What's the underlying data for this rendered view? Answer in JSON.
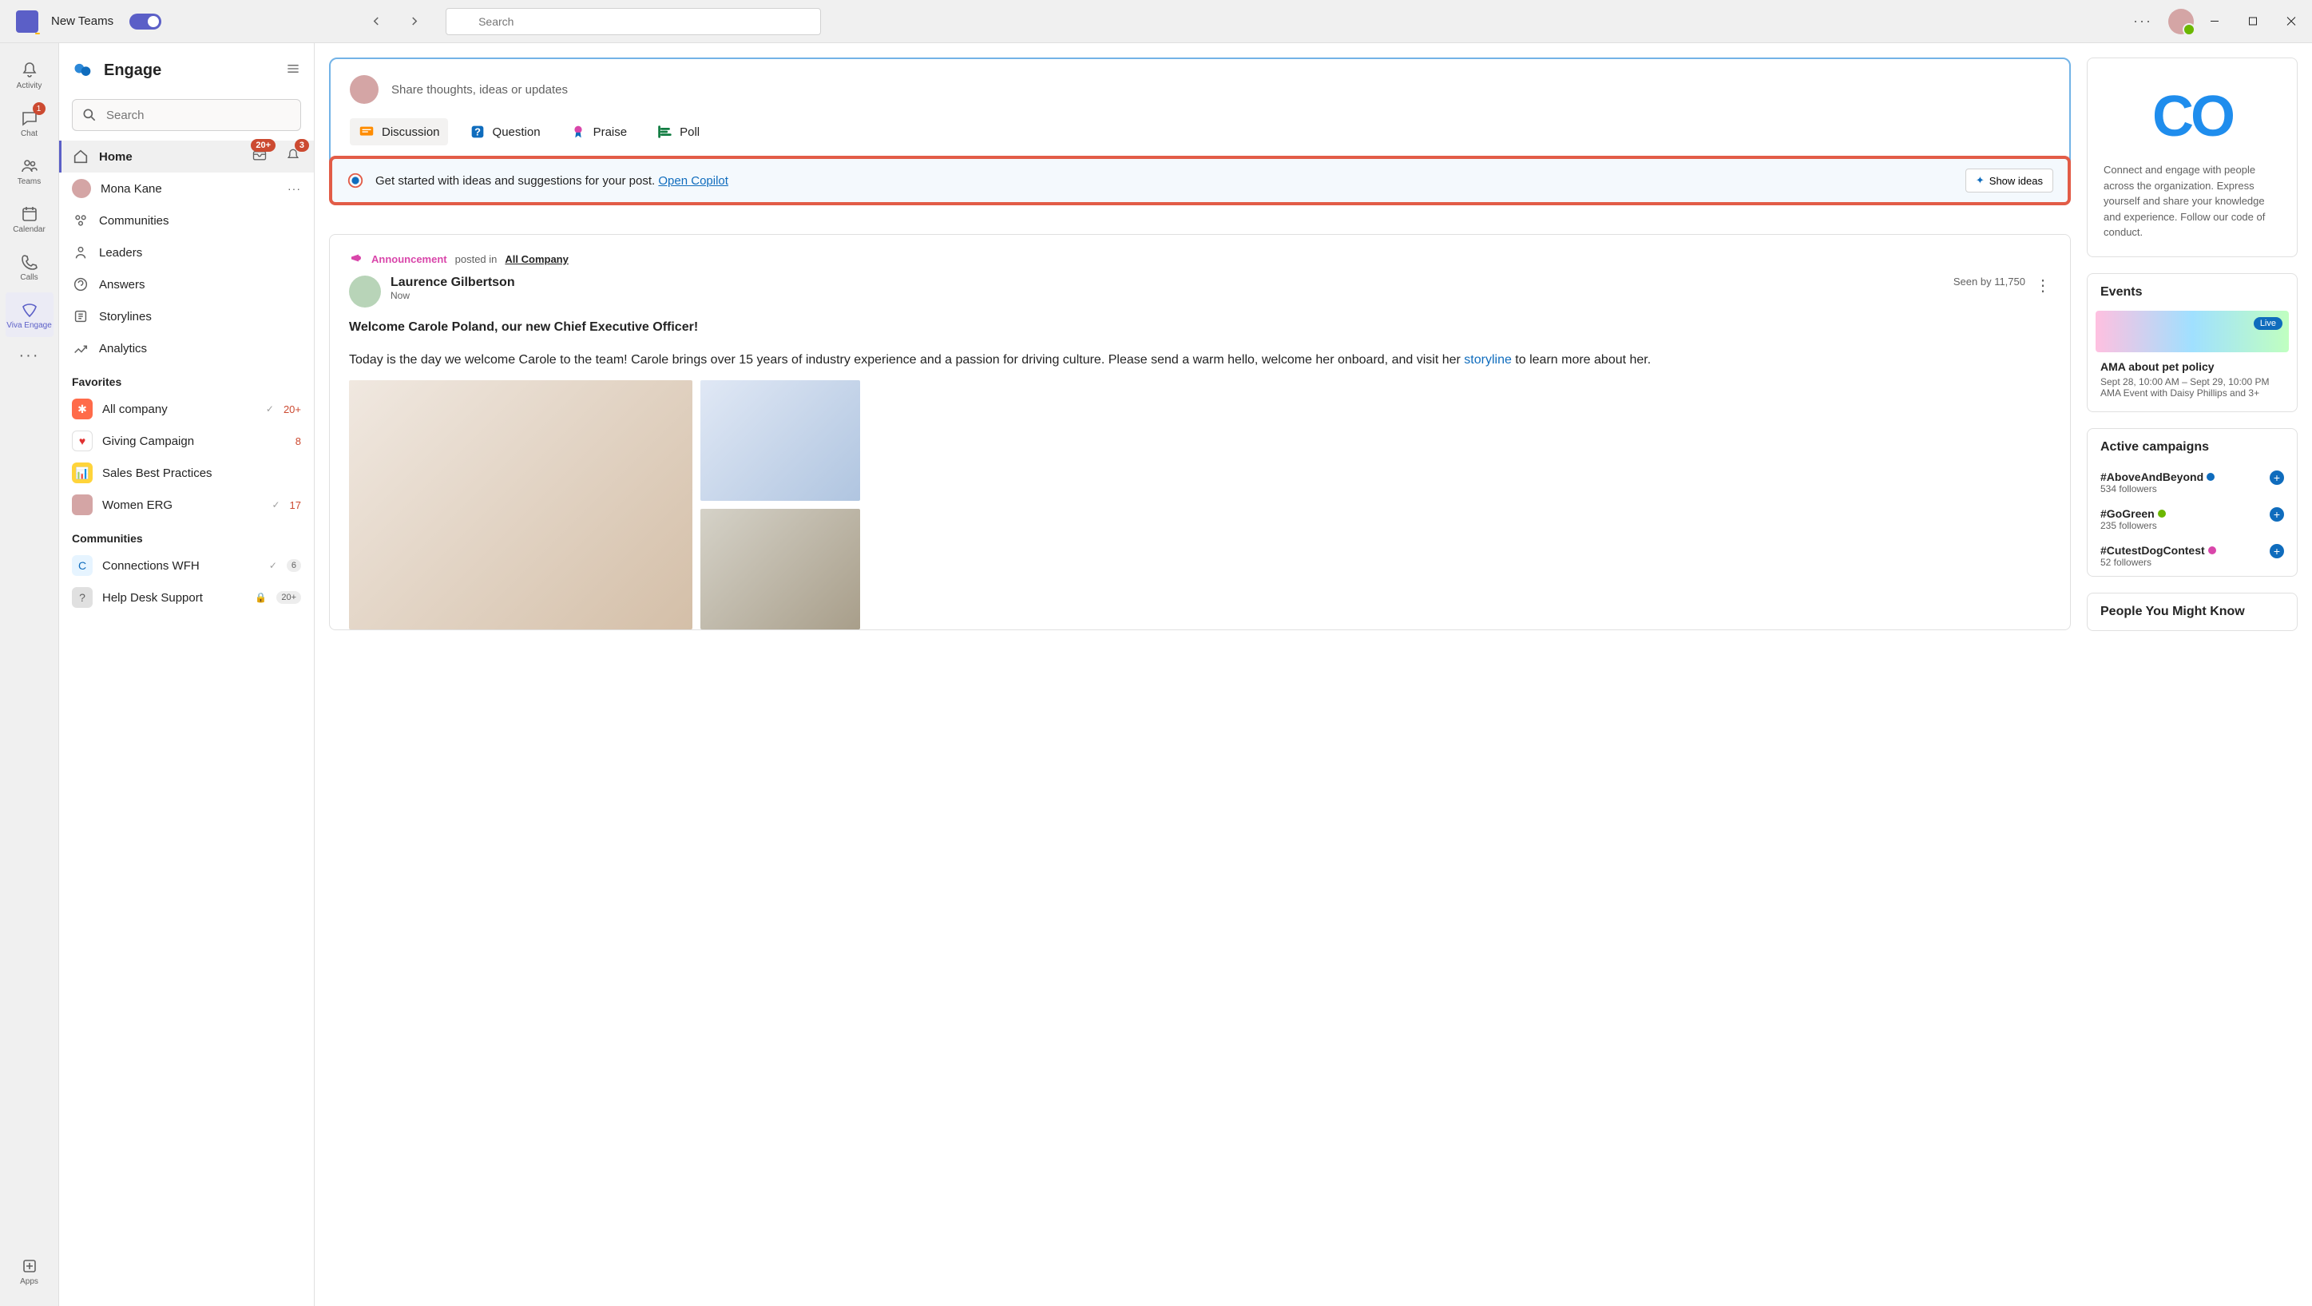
{
  "titlebar": {
    "app_name": "New Teams",
    "search_placeholder": "Search",
    "more": "···"
  },
  "rail": [
    {
      "key": "activity",
      "label": "Activity"
    },
    {
      "key": "chat",
      "label": "Chat",
      "badge": "1"
    },
    {
      "key": "teams",
      "label": "Teams"
    },
    {
      "key": "calendar",
      "label": "Calendar"
    },
    {
      "key": "calls",
      "label": "Calls"
    },
    {
      "key": "viva",
      "label": "Viva Engage"
    },
    {
      "key": "apps",
      "label": "Apps"
    }
  ],
  "sidebar": {
    "title": "Engage",
    "search_placeholder": "Search",
    "home": {
      "label": "Home",
      "inbox_badge": "20+",
      "bell_badge": "3"
    },
    "user": {
      "name": "Mona Kane"
    },
    "nav": [
      {
        "label": "Communities"
      },
      {
        "label": "Leaders"
      },
      {
        "label": "Answers"
      },
      {
        "label": "Storylines"
      },
      {
        "label": "Analytics"
      }
    ],
    "fav_header": "Favorites",
    "favorites": [
      {
        "label": "All company",
        "count": "20+",
        "count_class": "",
        "bg": "#ff6b4a"
      },
      {
        "label": "Giving Campaign",
        "count": "8",
        "count_class": "",
        "bg": "#fff",
        "fg": "#e03131"
      },
      {
        "label": "Sales Best Practices",
        "count": "",
        "count_class": "",
        "bg": "#ffd43b"
      },
      {
        "label": "Women ERG",
        "count": "17",
        "count_class": "",
        "bg": "#d4a5a5"
      }
    ],
    "comm_header": "Communities",
    "communities": [
      {
        "label": "Connections WFH",
        "count": "6",
        "bg": "#e6f4ff",
        "fg": "#0f6cbd"
      },
      {
        "label": "Help Desk Support",
        "count": "20+",
        "bg": "#e0e0e0",
        "fg": "#616161"
      }
    ]
  },
  "composer": {
    "placeholder": "Share thoughts, ideas or updates",
    "tabs": [
      {
        "label": "Discussion",
        "active": true,
        "color": "#ff8c00"
      },
      {
        "label": "Question",
        "color": "#0f6cbd"
      },
      {
        "label": "Praise",
        "color": "#d946aa"
      },
      {
        "label": "Poll",
        "color": "#107c41"
      }
    ]
  },
  "copilot": {
    "text": "Get started with ideas and suggestions for your post.",
    "link": "Open Copilot",
    "button": "Show ideas"
  },
  "post": {
    "ann_label": "Announcement",
    "posted_in": "posted in",
    "community": "All Company",
    "author": "Laurence Gilbertson",
    "time": "Now",
    "seen": "Seen by 11,750",
    "title": "Welcome Carole Poland, our new Chief Executive Officer!",
    "body_a": "Today is the day we welcome Carole to the team! Carole brings over 15 years of industry experience and a passion for driving culture. Please send a warm hello, welcome her onboard, and visit her ",
    "body_link": "storyline",
    "body_b": " to learn more about her."
  },
  "right": {
    "co_text": "Connect and engage with people across the organization. Express yourself and share your knowledge and experience. Follow our code of conduct.",
    "events_title": "Events",
    "event": {
      "live": "Live",
      "title": "AMA about pet policy",
      "time": "Sept 28, 10:00 AM – Sept 29, 10:00 PM",
      "sub": "AMA Event with Daisy Phillips and 3+"
    },
    "campaigns_title": "Active campaigns",
    "campaigns": [
      {
        "tag": "#AboveAndBeyond",
        "followers": "534 followers",
        "verify": "blue"
      },
      {
        "tag": "#GoGreen",
        "followers": "235 followers",
        "verify": "green"
      },
      {
        "tag": "#CutestDogContest",
        "followers": "52 followers",
        "verify": "pink"
      }
    ],
    "people_title": "People You Might Know"
  }
}
